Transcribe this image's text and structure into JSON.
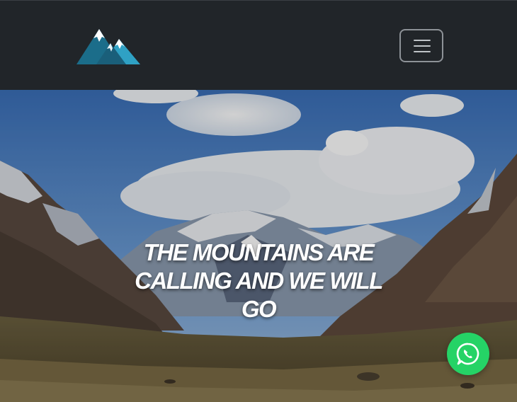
{
  "navbar": {
    "logo_icon": "mountain-logo-icon",
    "toggler_icon": "hamburger-menu-icon"
  },
  "hero": {
    "title": "THE MOUNTAINS ARE CALLING AND WE WILL GO"
  },
  "whatsapp": {
    "icon": "whatsapp-icon",
    "color": "#25d366"
  },
  "colors": {
    "navbar_bg": "#212529",
    "logo_dark": "#1b6d8a",
    "logo_light": "#2fa1c4",
    "logo_snow": "#ffffff"
  }
}
